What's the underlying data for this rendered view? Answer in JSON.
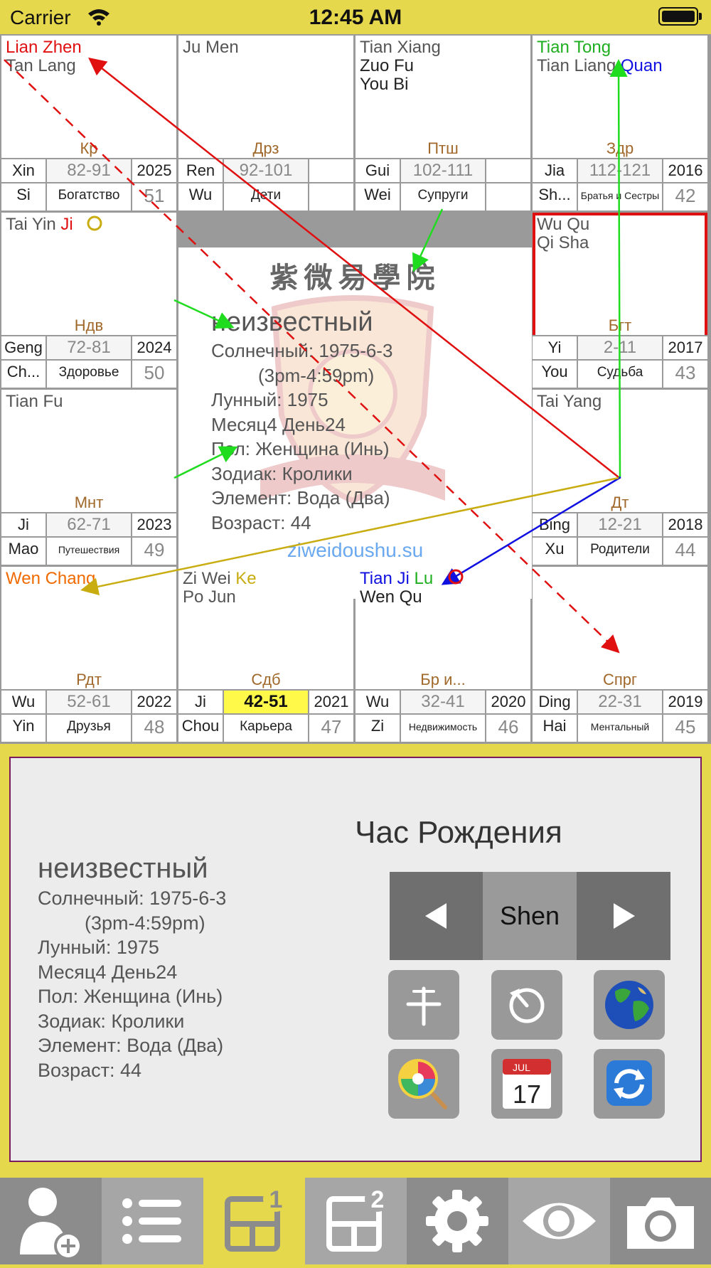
{
  "status_bar": {
    "carrier": "Carrier",
    "time": "12:45 AM"
  },
  "colors": {
    "background": "#e6d84c",
    "grid": "#9a9a9a",
    "palace_tag": "#a0682a",
    "highlight": "#fff94a",
    "selected_border": "#e01010",
    "site": "#6aa8ef"
  },
  "chart": {
    "cells": [
      {
        "id": "si",
        "stars": [
          [
            {
              "t": "Lian Zhen",
              "c": "red"
            }
          ],
          [
            {
              "t": "Tan Lang",
              "c": "gray"
            }
          ]
        ],
        "tag": "Кр",
        "stem": [
          "Xin",
          "Si"
        ],
        "range": "82-91",
        "palace": "Богатство",
        "year": "2025",
        "age": "51"
      },
      {
        "id": "wu",
        "stars": [
          [
            {
              "t": "Ju Men",
              "c": "gray"
            }
          ]
        ],
        "tag": "Дрз",
        "stem": [
          "Ren",
          "Wu"
        ],
        "range": "92-101",
        "palace": "Дети",
        "year": "",
        "age": ""
      },
      {
        "id": "wei",
        "stars": [
          [
            {
              "t": "Tian Xiang",
              "c": "gray"
            }
          ],
          [
            {
              "t": "Zuo Fu",
              "c": "dark"
            }
          ],
          [
            {
              "t": "You Bi",
              "c": "dark"
            }
          ]
        ],
        "tag": "Птш",
        "stem": [
          "Gui",
          "Wei"
        ],
        "range": "102-111",
        "palace": "Супруги",
        "year": "",
        "age": ""
      },
      {
        "id": "shen",
        "stars": [
          [
            {
              "t": "Tian Tong",
              "c": "green"
            }
          ],
          [
            {
              "t": "Tian Liang ",
              "c": "gray"
            },
            {
              "t": "Quan",
              "c": "blue"
            }
          ]
        ],
        "tag": "Здр",
        "stem": [
          "Jia",
          "Sh..."
        ],
        "range": "112-121",
        "palace": "Братья и Сестры",
        "year": "2016",
        "age": "42"
      },
      {
        "id": "chen",
        "stars": [
          [
            {
              "t": "Tai Yin ",
              "c": "gray"
            },
            {
              "t": "Ji",
              "c": "red"
            }
          ]
        ],
        "tag": "Ндв",
        "stem": [
          "Geng",
          "Ch..."
        ],
        "range": "72-81",
        "palace": "Здоровье",
        "year": "2024",
        "age": "50"
      },
      {
        "id": "you",
        "stars": [
          [
            {
              "t": "Wu Qu",
              "c": "gray"
            }
          ],
          [
            {
              "t": "Qi Sha",
              "c": "gray"
            }
          ]
        ],
        "tag": "Бгт",
        "stem": [
          "Yi",
          "You"
        ],
        "range": "2-11",
        "palace": "Судьба",
        "year": "2017",
        "age": "43"
      },
      {
        "id": "mao",
        "stars": [
          [
            {
              "t": "Tian Fu",
              "c": "gray"
            }
          ]
        ],
        "tag": "Мнт",
        "stem": [
          "Ji",
          "Mao"
        ],
        "range": "62-71",
        "palace": "Путешествия",
        "year": "2023",
        "age": "49"
      },
      {
        "id": "xu",
        "stars": [
          [
            {
              "t": "Tai Yang",
              "c": "gray"
            }
          ]
        ],
        "tag": "Дт",
        "stem": [
          "Bing",
          "Xu"
        ],
        "range": "12-21",
        "palace": "Родители",
        "year": "2018",
        "age": "44"
      },
      {
        "id": "yin",
        "stars": [
          [
            {
              "t": "Wen Chang",
              "c": "orange"
            }
          ]
        ],
        "tag": "Рдт",
        "stem": [
          "Wu",
          "Yin"
        ],
        "range": "52-61",
        "palace": "Друзья",
        "year": "2022",
        "age": "48"
      },
      {
        "id": "chou",
        "stars": [
          [
            {
              "t": "Zi Wei ",
              "c": "gray"
            },
            {
              "t": "Ke",
              "c": "gold"
            }
          ],
          [
            {
              "t": "Po Jun",
              "c": "gray"
            }
          ]
        ],
        "tag": "Сдб",
        "stem": [
          "Ji",
          "Chou"
        ],
        "range": "42-51",
        "palace": "Карьера",
        "year": "2021",
        "age": "47"
      },
      {
        "id": "zi",
        "stars": [
          [
            {
              "t": "Tian Ji ",
              "c": "blue"
            },
            {
              "t": "Lu",
              "c": "green"
            }
          ],
          [
            {
              "t": "Wen Qu",
              "c": "dark"
            }
          ]
        ],
        "tag": "Бр и...",
        "stem": [
          "Wu",
          "Zi"
        ],
        "range": "32-41",
        "palace": "Недвижимость",
        "year": "2020",
        "age": "46"
      },
      {
        "id": "hai",
        "stars": [],
        "tag": "Спрг",
        "stem": [
          "Ding",
          "Hai"
        ],
        "range": "22-31",
        "palace": "Ментальный",
        "year": "2019",
        "age": "45"
      }
    ],
    "center": {
      "school": "紫微易學院",
      "name": "неизвестный",
      "solar": "Солнечный: 1975-6-3",
      "hours": "(3pm-4:59pm)",
      "lunar": "Лунный: 1975",
      "month_day": "Месяц4 День24",
      "gender": "Пол: Женщина (Инь)",
      "zodiac": "Зодиак: Кролики",
      "element": "Элемент: Вода (Два)",
      "age": "Возраст: 44",
      "site": "ziweidoushu.su"
    }
  },
  "panel": {
    "name": "неизвестный",
    "solar": "Солнечный: 1975-6-3",
    "hours": "(3pm-4:59pm)",
    "lunar": "Лунный: 1975",
    "month_day": "Месяц4 День24",
    "gender": "Пол: Женщина (Инь)",
    "zodiac": "Зодиак: Кролики",
    "element": "Элемент: Вода (Два)",
    "age": "Возраст: 44",
    "hour_title": "Час Рождения",
    "hour_value": "Shen",
    "calendar_month": "JUL",
    "calendar_day": "17"
  },
  "tabbar": {
    "items": [
      "add-person",
      "list",
      "chart-1",
      "chart-2",
      "settings",
      "view",
      "camera"
    ],
    "badges": {
      "chart-1": "1",
      "chart-2": "2"
    },
    "active": "chart-1"
  }
}
